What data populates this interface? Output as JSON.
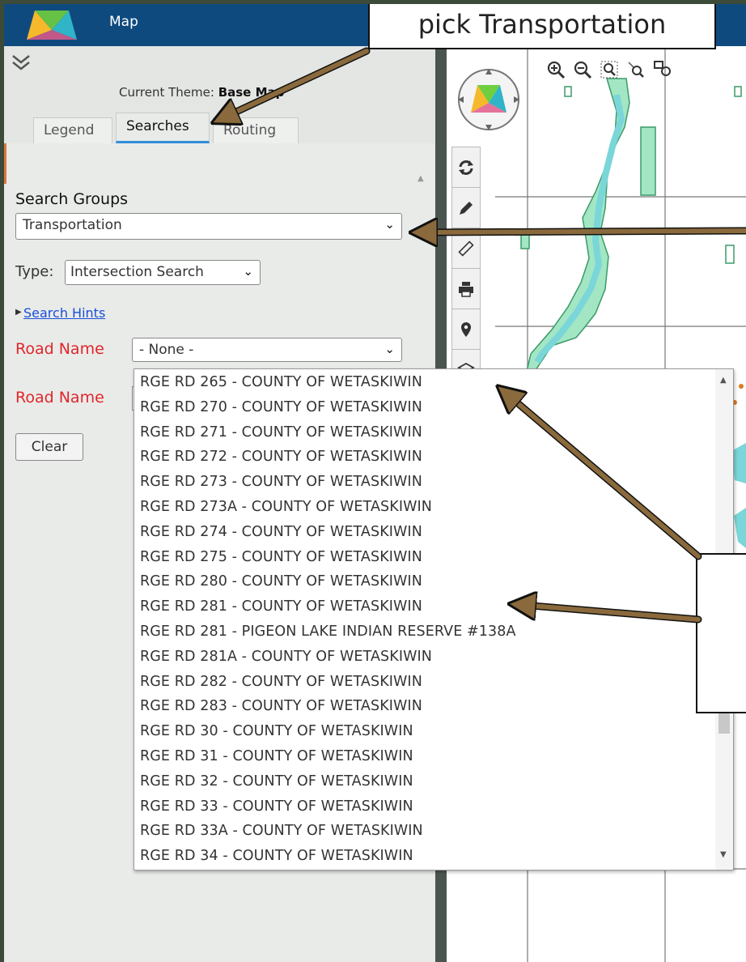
{
  "header": {
    "title": "Map"
  },
  "left_panel": {
    "theme_label": "Current Theme:",
    "theme_value": "Base Map",
    "tabs": [
      {
        "label": "Legend"
      },
      {
        "label": "Searches"
      },
      {
        "label": "Routing"
      }
    ],
    "search_groups_label": "Search Groups",
    "search_group_value": "Transportation",
    "type_label": "Type:",
    "type_value": "Intersection Search",
    "search_hints": "Search Hints",
    "road_name_label_1": "Road Name",
    "road_name_value_1": "- None -",
    "road_name_label_2": "Road Name",
    "clear_button": "Clear"
  },
  "dropdown_options": [
    "RGE RD 265 - COUNTY OF WETASKIWIN",
    "RGE RD 270 - COUNTY OF WETASKIWIN",
    "RGE RD 271 - COUNTY OF WETASKIWIN",
    "RGE RD 272 - COUNTY OF WETASKIWIN",
    "RGE RD 273 - COUNTY OF WETASKIWIN",
    "RGE RD 273A - COUNTY OF WETASKIWIN",
    "RGE RD 274 - COUNTY OF WETASKIWIN",
    "RGE RD 275 - COUNTY OF WETASKIWIN",
    "RGE RD 280 - COUNTY OF WETASKIWIN",
    "RGE RD 281 - COUNTY OF WETASKIWIN",
    "RGE RD 281 - PIGEON LAKE INDIAN RESERVE #138A",
    "RGE RD 281A - COUNTY OF WETASKIWIN",
    "RGE RD 282 - COUNTY OF WETASKIWIN",
    "RGE RD 283 - COUNTY OF WETASKIWIN",
    "RGE RD 30 - COUNTY OF WETASKIWIN",
    "RGE RD 31 - COUNTY OF WETASKIWIN",
    "RGE RD 32 - COUNTY OF WETASKIWIN",
    "RGE RD 33 - COUNTY OF WETASKIWIN",
    "RGE RD 33A - COUNTY OF WETASKIWIN",
    "RGE RD 34 - COUNTY OF WETASKIWIN"
  ],
  "callouts": {
    "top": "pick Transportation"
  },
  "icons": {
    "zoom_in": "zoom-in-icon",
    "zoom_out": "zoom-out-icon",
    "zoom_box": "zoom-box-icon",
    "zoom_extent": "zoom-extent-icon",
    "pan": "pan-icon",
    "refresh": "refresh-icon",
    "pencil": "pencil-icon",
    "ruler": "ruler-icon",
    "print": "print-icon",
    "location": "location-pin-icon",
    "layers": "layers-icon"
  },
  "colors": {
    "header": "#0f4a7f",
    "required_label": "#e0262b",
    "link": "#1a4fd6",
    "tab_active_underline": "#2f8ed8",
    "map_water": "#7ad6d8",
    "map_park": "#a3e6c4",
    "arrow": "#8a6a3c"
  }
}
